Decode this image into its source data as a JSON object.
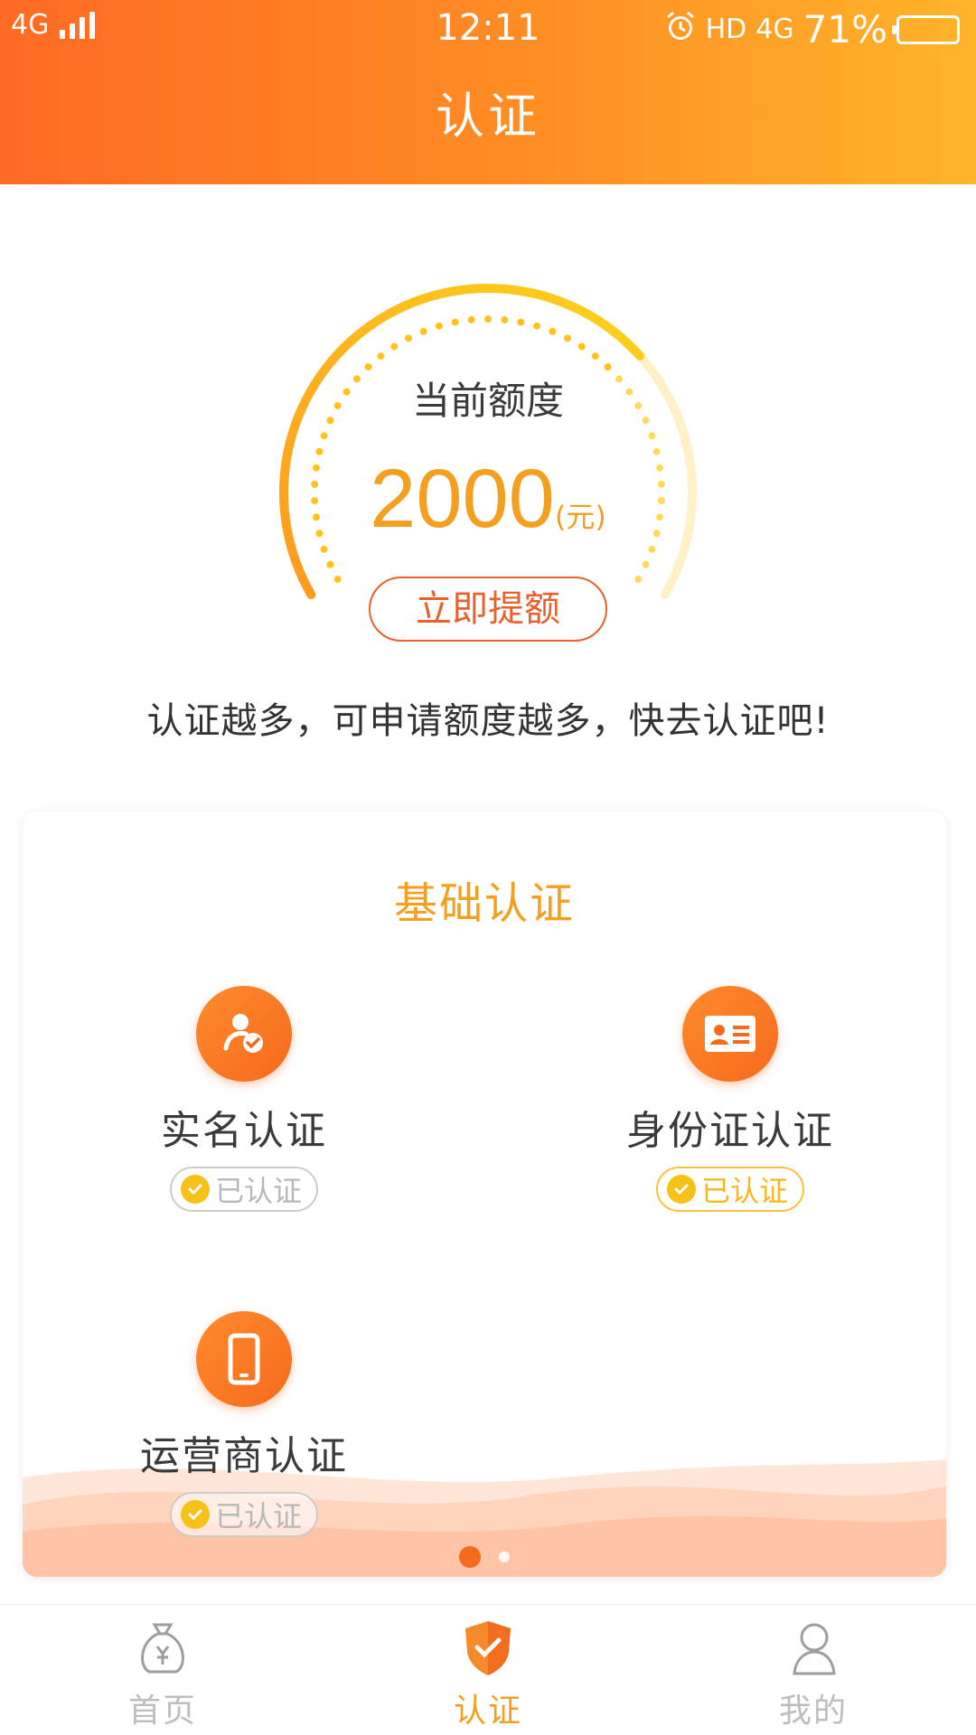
{
  "status_bar": {
    "network_left": "4G",
    "time": "12:11",
    "hd": "HD",
    "network_right": "4G",
    "battery_percent": "71%",
    "battery_level": 0.71
  },
  "header": {
    "title": "认证"
  },
  "gauge": {
    "label": "当前额度",
    "amount": "2000",
    "unit": "(元)",
    "button_label": "立即提额",
    "fill_fraction": 0.7
  },
  "tip": "认证越多，可申请额度越多，快去认证吧!",
  "basic_card": {
    "title": "基础认证",
    "items": [
      {
        "label": "实名认证",
        "status": "已认证",
        "icon": "user-check-icon"
      },
      {
        "label": "身份证认证",
        "status": "已认证",
        "icon": "id-card-icon"
      },
      {
        "label": "运营商认证",
        "status": "已认证",
        "icon": "mobile-phone-icon"
      }
    ],
    "page_count": 2,
    "active_page": 1
  },
  "tabbar": {
    "tabs": [
      {
        "label": "首页",
        "icon": "money-bag-icon",
        "active": false
      },
      {
        "label": "认证",
        "icon": "shield-check-icon",
        "active": true
      },
      {
        "label": "我的",
        "icon": "person-icon",
        "active": false
      }
    ]
  },
  "colors": {
    "header_start": "#ff6a24",
    "header_end": "#ffb42a",
    "accent": "#f3a020",
    "button_border": "#e8602c",
    "icon_orange": "#f56a1d",
    "badge_yellow": "#f6c21a"
  }
}
